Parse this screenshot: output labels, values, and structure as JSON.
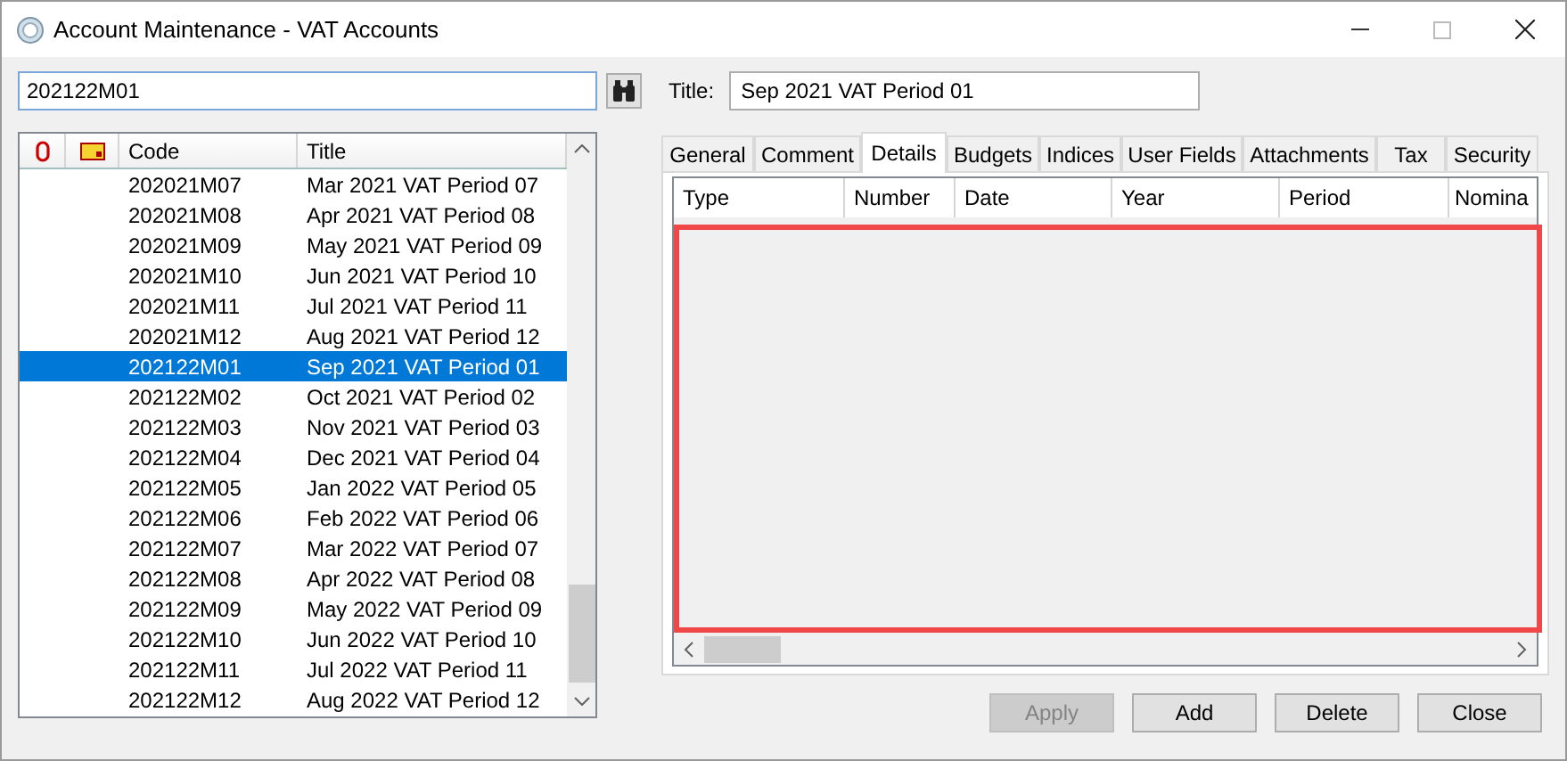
{
  "window": {
    "title": "Account Maintenance - VAT Accounts"
  },
  "search": {
    "value": "202122M01"
  },
  "list": {
    "columns": [
      "Code",
      "Title"
    ],
    "rows": [
      {
        "code": "202021M07",
        "title": "Mar 2021 VAT Period 07",
        "selected": false
      },
      {
        "code": "202021M08",
        "title": "Apr 2021 VAT Period 08",
        "selected": false
      },
      {
        "code": "202021M09",
        "title": "May 2021 VAT Period 09",
        "selected": false
      },
      {
        "code": "202021M10",
        "title": "Jun 2021 VAT Period 10",
        "selected": false
      },
      {
        "code": "202021M11",
        "title": "Jul 2021 VAT Period 11",
        "selected": false
      },
      {
        "code": "202021M12",
        "title": "Aug 2021 VAT Period 12",
        "selected": false
      },
      {
        "code": "202122M01",
        "title": "Sep 2021 VAT Period 01",
        "selected": true
      },
      {
        "code": "202122M02",
        "title": "Oct 2021 VAT Period 02",
        "selected": false
      },
      {
        "code": "202122M03",
        "title": "Nov 2021 VAT Period 03",
        "selected": false
      },
      {
        "code": "202122M04",
        "title": "Dec 2021 VAT Period 04",
        "selected": false
      },
      {
        "code": "202122M05",
        "title": "Jan 2022 VAT Period 05",
        "selected": false
      },
      {
        "code": "202122M06",
        "title": "Feb 2022 VAT Period 06",
        "selected": false
      },
      {
        "code": "202122M07",
        "title": "Mar 2022 VAT Period 07",
        "selected": false
      },
      {
        "code": "202122M08",
        "title": "Apr 2022 VAT Period 08",
        "selected": false
      },
      {
        "code": "202122M09",
        "title": "May 2022 VAT Period 09",
        "selected": false
      },
      {
        "code": "202122M10",
        "title": "Jun 2022 VAT Period 10",
        "selected": false
      },
      {
        "code": "202122M11",
        "title": "Jul 2022 VAT Period 11",
        "selected": false
      },
      {
        "code": "202122M12",
        "title": "Aug 2022 VAT Period 12",
        "selected": false
      }
    ]
  },
  "title_field": {
    "label": "Title:",
    "value": "Sep 2021 VAT Period 01"
  },
  "tabs": [
    {
      "label": "General",
      "selected": false
    },
    {
      "label": "Comment",
      "selected": false
    },
    {
      "label": "Details",
      "selected": true
    },
    {
      "label": "Budgets",
      "selected": false
    },
    {
      "label": "Indices",
      "selected": false
    },
    {
      "label": "User Fields",
      "selected": false
    },
    {
      "label": "Attachments",
      "selected": false
    },
    {
      "label": "Tax",
      "selected": false
    },
    {
      "label": "Security",
      "selected": false
    }
  ],
  "details_grid": {
    "columns": [
      "Type",
      "Number",
      "Date",
      "Year",
      "Period",
      "Nomina"
    ]
  },
  "buttons": [
    {
      "label": "Apply",
      "disabled": true
    },
    {
      "label": "Add",
      "disabled": false
    },
    {
      "label": "Delete",
      "disabled": false
    },
    {
      "label": "Close",
      "disabled": false
    }
  ],
  "annotation": {
    "kind": "highlight"
  }
}
